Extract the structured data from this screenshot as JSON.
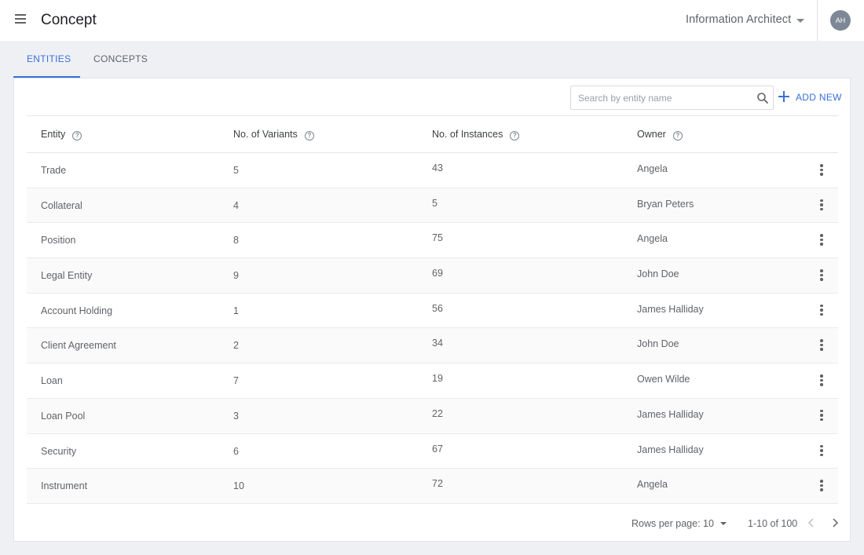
{
  "header": {
    "title": "Concept",
    "role": "Information Architect",
    "avatar_initials": "AH"
  },
  "tabs": [
    {
      "label": "ENTITIES",
      "active": true
    },
    {
      "label": "CONCEPTS",
      "active": false
    }
  ],
  "toolbar": {
    "search_placeholder": "Search by entity name",
    "add_new_label": "ADD NEW"
  },
  "table": {
    "columns": [
      "Entity",
      "No. of Variants",
      "No. of Instances",
      "Owner"
    ],
    "rows": [
      {
        "entity": "Trade",
        "variants": "5",
        "instances": "43",
        "owner": "Angela"
      },
      {
        "entity": "Collateral",
        "variants": "4",
        "instances": "5",
        "owner": "Bryan Peters"
      },
      {
        "entity": "Position",
        "variants": "8",
        "instances": "75",
        "owner": "Angela"
      },
      {
        "entity": "Legal Entity",
        "variants": "9",
        "instances": "69",
        "owner": "John Doe"
      },
      {
        "entity": "Account Holding",
        "variants": "1",
        "instances": "56",
        "owner": "James Halliday"
      },
      {
        "entity": "Client Agreement",
        "variants": "2",
        "instances": "34",
        "owner": "John Doe"
      },
      {
        "entity": "Loan",
        "variants": "7",
        "instances": "19",
        "owner": "Owen Wilde"
      },
      {
        "entity": "Loan Pool",
        "variants": "3",
        "instances": "22",
        "owner": "James Halliday"
      },
      {
        "entity": "Security",
        "variants": "6",
        "instances": "67",
        "owner": "James Halliday"
      },
      {
        "entity": "Instrument",
        "variants": "10",
        "instances": "72",
        "owner": "Angela"
      }
    ]
  },
  "pagination": {
    "rows_per_page_label": "Rows per page:",
    "rows_per_page_value": "10",
    "range_label": "1-10 of 100"
  },
  "colors": {
    "accent": "#3a6fd8",
    "background": "#eef0f4",
    "avatar": "#7d8796"
  },
  "icons": [
    "menu-icon",
    "dropdown-caret-icon",
    "search-icon",
    "plus-icon",
    "help-icon",
    "more-vert-icon",
    "chevron-left-icon",
    "chevron-right-icon"
  ]
}
